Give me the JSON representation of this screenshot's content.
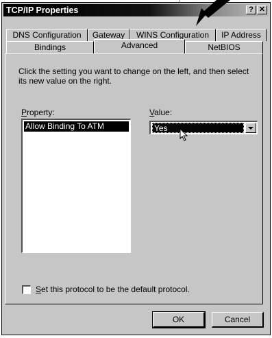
{
  "window": {
    "title": "TCP/IP Properties",
    "help_button": "?",
    "close_button": "✕"
  },
  "tabs": {
    "row1": [
      "DNS Configuration",
      "Gateway",
      "WINS Configuration",
      "IP Address"
    ],
    "row2": [
      "Bindings",
      "Advanced",
      "NetBIOS"
    ],
    "active": "Advanced"
  },
  "panel": {
    "instructions": "Click the setting you want to change on the left, and then select its new value on the right.",
    "property_label_first": "P",
    "property_label_rest": "roperty:",
    "value_label_first": "V",
    "value_label_rest": "alue:",
    "properties": [
      "Allow Binding To ATM"
    ],
    "value_selected": "Yes",
    "checkbox_first": "S",
    "checkbox_rest": "et this protocol to be the default protocol.",
    "checkbox_checked": false
  },
  "buttons": {
    "ok": "OK",
    "cancel": "Cancel"
  },
  "icons": {
    "dropdown": "chevron-down-icon",
    "pointer": "mouse-cursor-icon",
    "callout": "callout-arrow-icon"
  }
}
